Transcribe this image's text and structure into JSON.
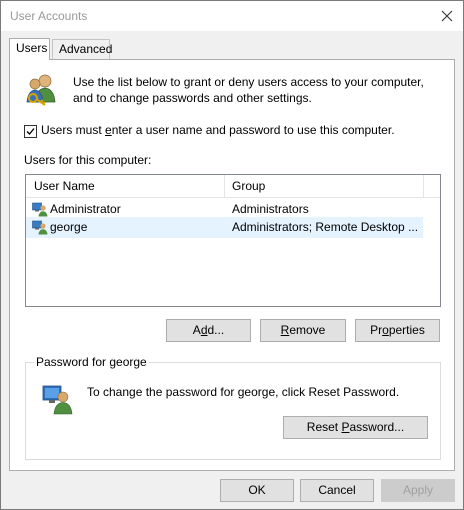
{
  "window": {
    "title": "User Accounts",
    "close_icon": "close-icon"
  },
  "tabs": [
    {
      "label": "Users"
    },
    {
      "label": "Advanced"
    }
  ],
  "users_tab": {
    "intro": "Use the list below to grant or deny users access to your computer, and to change passwords and other settings.",
    "require_login": {
      "label_before": "Users must ",
      "label_access": "e",
      "label_after": "nter a user name and password to use this computer.",
      "checked": true
    },
    "users_label": "Users for this computer:",
    "columns": [
      "User Name",
      "Group"
    ],
    "rows": [
      {
        "name": "Administrator",
        "group": "Administrators",
        "selected": false
      },
      {
        "name": "george",
        "group": "Administrators; Remote Desktop ...",
        "selected": true
      }
    ],
    "buttons": {
      "add": {
        "pre": "A",
        "access": "d",
        "post": "d..."
      },
      "remove": {
        "pre": "",
        "access": "R",
        "post": "emove"
      },
      "properties": {
        "pre": "Pr",
        "access": "o",
        "post": "perties"
      }
    },
    "password_group": {
      "title": "Password for george",
      "text": "To change the password for george, click Reset Password.",
      "reset": {
        "pre": "Reset ",
        "access": "P",
        "post": "assword..."
      }
    }
  },
  "footer": {
    "ok": "OK",
    "cancel": "Cancel",
    "apply": "Apply"
  }
}
